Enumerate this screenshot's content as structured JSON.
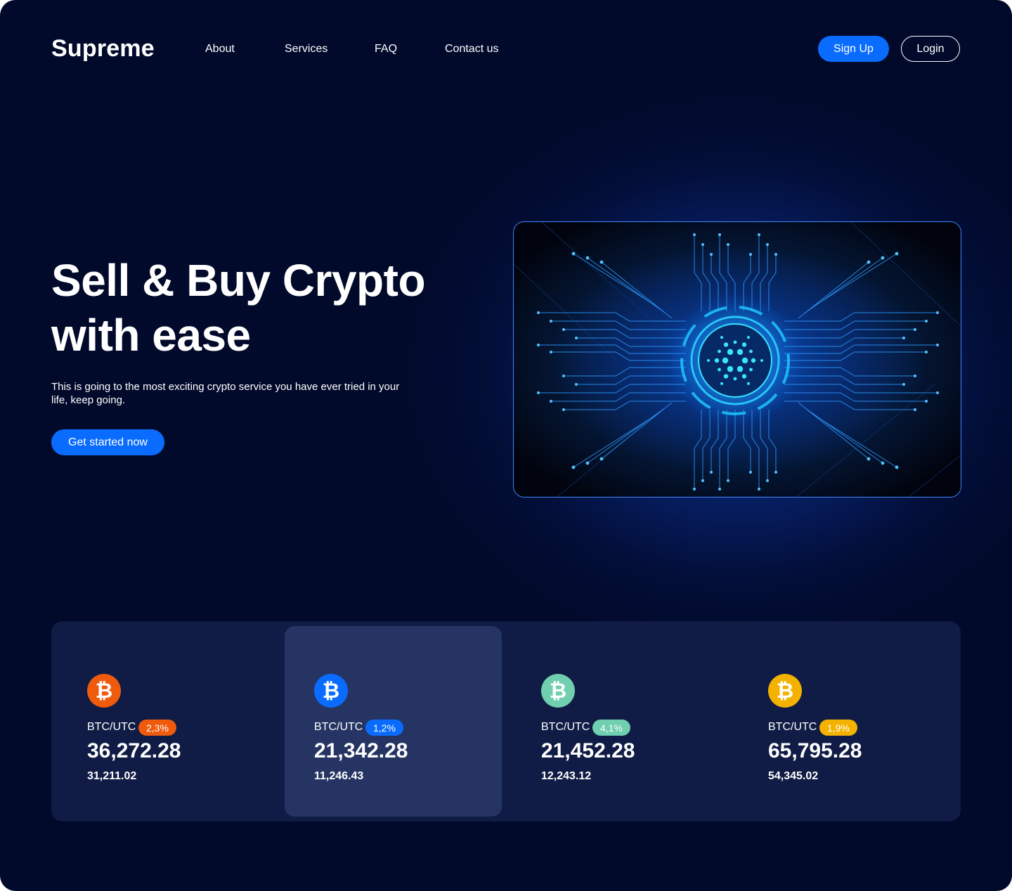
{
  "brand": {
    "name": "Supreme"
  },
  "nav": {
    "links": [
      "About",
      "Services",
      "FAQ",
      "Contact us"
    ],
    "signup_label": "Sign Up",
    "login_label": "Login"
  },
  "hero": {
    "title_line1": "Sell & Buy Crypto",
    "title_line2": "with ease",
    "subtitle": "This is going to the most exciting crypto service you have ever tried in your life, keep going.",
    "cta_label": "Get started now",
    "image_icon": "cardano-circuit-illustration"
  },
  "tickers": [
    {
      "pair": "BTC/UTC",
      "change": "2,3%",
      "price": "36,272.28",
      "secondary": "31,211.02",
      "color": "#f05a0d",
      "icon": "bitcoin-icon",
      "active": false
    },
    {
      "pair": "BTC/UTC",
      "change": "1,2%",
      "price": "21,342.28",
      "secondary": "11,246.43",
      "color": "#0a6cff",
      "icon": "bitcoin-icon",
      "active": true
    },
    {
      "pair": "BTC/UTC",
      "change": "4,1%",
      "price": "21,452.28",
      "secondary": "12,243.12",
      "color": "#6fcfae",
      "icon": "bitcoin-icon",
      "active": false
    },
    {
      "pair": "BTC/UTC",
      "change": "1,9%",
      "price": "65,795.28",
      "secondary": "54,345.02",
      "color": "#f4b200",
      "icon": "bitcoin-icon",
      "active": false
    }
  ],
  "colors": {
    "background": "#020a2b",
    "accent": "#0a6cff",
    "panel": "#101c45",
    "panel_active": "#253463"
  }
}
